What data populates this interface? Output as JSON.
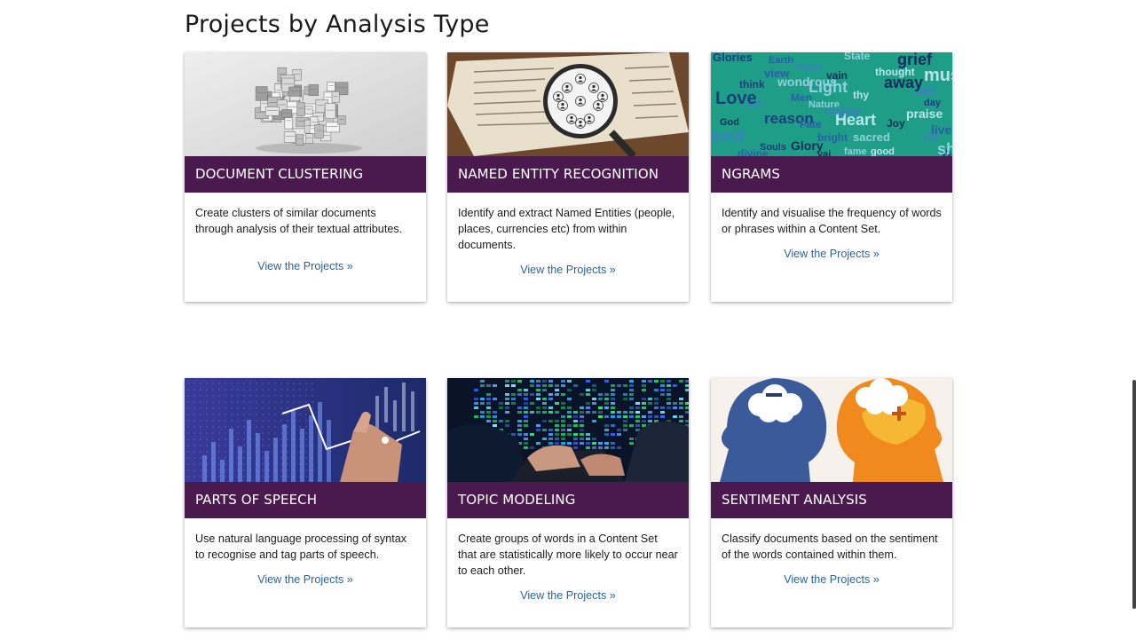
{
  "page": {
    "section_title": "Projects by Analysis Type"
  },
  "cards": [
    {
      "title": "DOCUMENT CLUSTERING",
      "description": "Create clusters of similar documents through analysis of their textual attributes.",
      "link": "View the Projects »"
    },
    {
      "title": "NAMED ENTITY RECOGNITION",
      "description": "Identify and extract Named Entities (people, places, currencies etc) from within documents.",
      "link": "View the Projects »"
    },
    {
      "title": "NGRAMS",
      "description": "Identify and visualise the frequency of words or phrases within a Content Set.",
      "link": "View the Projects »"
    },
    {
      "title": "PARTS OF SPEECH",
      "description": "Use natural language processing of syntax to recognise and tag parts of speech.",
      "link": "View the Projects »"
    },
    {
      "title": "TOPIC MODELING",
      "description": "Create groups of words in a Content Set that are statistically more likely to occur near to each other.",
      "link": "View the Projects »"
    },
    {
      "title": "SENTIMENT ANALYSIS",
      "description": "Classify documents based on the sentiment of the words contained within them.",
      "link": "View the Projects »"
    }
  ],
  "ngram_words": [
    "Glories",
    "Earth",
    "State",
    "grief",
    "mus",
    "fair",
    "think",
    "view",
    "Light",
    "away",
    "thy",
    "Art",
    "Love",
    "Men",
    "Nature",
    "God",
    "Heart",
    "mighty",
    "reason",
    "Fate",
    "sacred",
    "Joy",
    "praise",
    "soul",
    "Souls",
    "bright",
    "fame",
    "Glory",
    "good",
    "till",
    "pay",
    "divine",
    "wondrous",
    "vain",
    "thought",
    "Youth",
    "day",
    "live",
    "sha",
    "vai"
  ],
  "colors": {
    "header_bg": "#4a1a4f",
    "link": "#2a6496",
    "ngram_bg": "#1e9e86"
  }
}
